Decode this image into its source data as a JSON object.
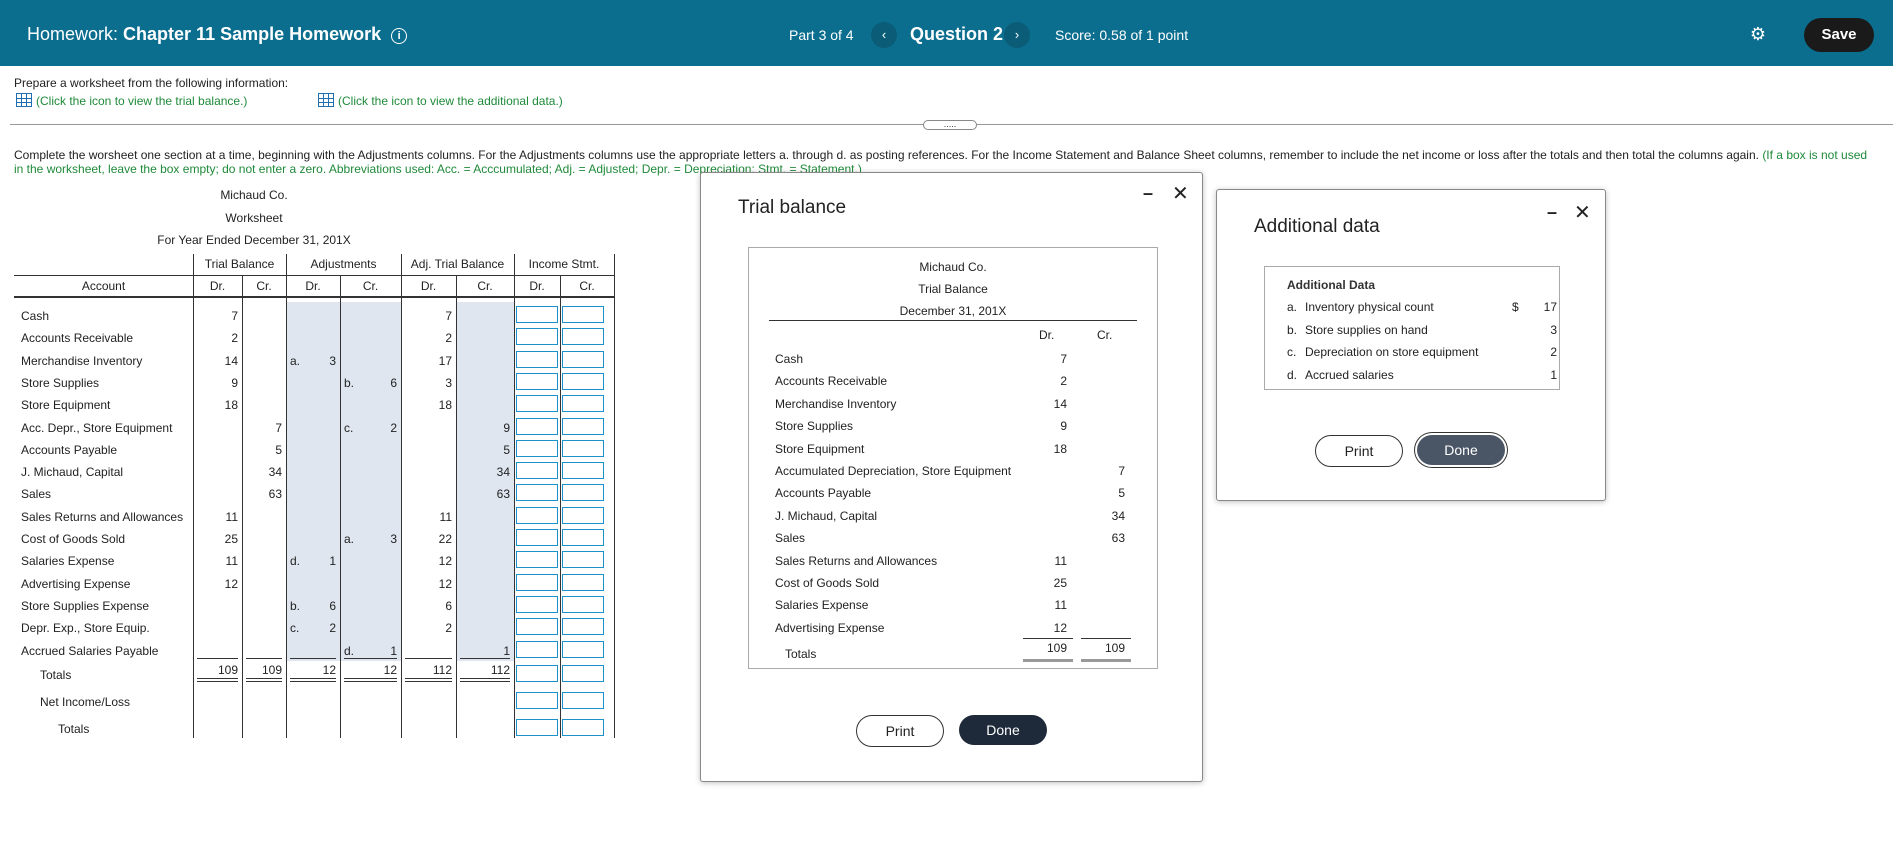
{
  "header": {
    "homework_prefix": "Homework:",
    "homework_title": "Chapter 11 Sample Homework",
    "part": "Part 3 of 4",
    "question": "Question 2",
    "score": "Score: 0.58 of 1 point",
    "save_label": "Save"
  },
  "prompt": {
    "prepare": "Prepare a worksheet from the following information:",
    "link_trial": "(Click the icon to view the trial balance.)",
    "link_additional": "(Click the icon to view the additional data.)",
    "instructions": "Complete the worsheet one section at a time, beginning with the Adjustments columns. For the Adjustments columns use the appropriate letters a. through d. as posting references. For the Income Statement and Balance Sheet columns, remember to include the net income or loss after the totals and then total the columns again.",
    "instructions_green": "(If a box is not used in the worksheet, leave the box empty; do not enter a zero. Abbreviations used: Acc. = Acccumulated; Adj. = Adjusted; Depr. = Depreciation; Stmt. = Statement.)"
  },
  "worksheet": {
    "company": "Michaud Co.",
    "title": "Worksheet",
    "period": "For Year Ended December 31, 201X",
    "groups": [
      "Trial Balance",
      "Adjustments",
      "Adj. Trial Balance",
      "Income Stmt."
    ],
    "account_header": "Account",
    "dr": "Dr.",
    "cr": "Cr.",
    "rows": [
      {
        "account": "Cash",
        "tb_dr": "7",
        "tb_cr": "",
        "adj_dr_ref": "",
        "adj_dr": "",
        "adj_cr_ref": "",
        "adj_cr": "",
        "atb_dr": "7",
        "atb_cr": ""
      },
      {
        "account": "Accounts Receivable",
        "tb_dr": "2",
        "tb_cr": "",
        "adj_dr_ref": "",
        "adj_dr": "",
        "adj_cr_ref": "",
        "adj_cr": "",
        "atb_dr": "2",
        "atb_cr": ""
      },
      {
        "account": "Merchandise Inventory",
        "tb_dr": "14",
        "tb_cr": "",
        "adj_dr_ref": "a.",
        "adj_dr": "3",
        "adj_cr_ref": "",
        "adj_cr": "",
        "atb_dr": "17",
        "atb_cr": ""
      },
      {
        "account": "Store Supplies",
        "tb_dr": "9",
        "tb_cr": "",
        "adj_dr_ref": "",
        "adj_dr": "",
        "adj_cr_ref": "b.",
        "adj_cr": "6",
        "atb_dr": "3",
        "atb_cr": ""
      },
      {
        "account": "Store Equipment",
        "tb_dr": "18",
        "tb_cr": "",
        "adj_dr_ref": "",
        "adj_dr": "",
        "adj_cr_ref": "",
        "adj_cr": "",
        "atb_dr": "18",
        "atb_cr": ""
      },
      {
        "account": "Acc. Depr., Store Equipment",
        "tb_dr": "",
        "tb_cr": "7",
        "adj_dr_ref": "",
        "adj_dr": "",
        "adj_cr_ref": "c.",
        "adj_cr": "2",
        "atb_dr": "",
        "atb_cr": "9"
      },
      {
        "account": "Accounts Payable",
        "tb_dr": "",
        "tb_cr": "5",
        "adj_dr_ref": "",
        "adj_dr": "",
        "adj_cr_ref": "",
        "adj_cr": "",
        "atb_dr": "",
        "atb_cr": "5"
      },
      {
        "account": "J. Michaud, Capital",
        "tb_dr": "",
        "tb_cr": "34",
        "adj_dr_ref": "",
        "adj_dr": "",
        "adj_cr_ref": "",
        "adj_cr": "",
        "atb_dr": "",
        "atb_cr": "34"
      },
      {
        "account": "Sales",
        "tb_dr": "",
        "tb_cr": "63",
        "adj_dr_ref": "",
        "adj_dr": "",
        "adj_cr_ref": "",
        "adj_cr": "",
        "atb_dr": "",
        "atb_cr": "63"
      },
      {
        "account": "Sales Returns and Allowances",
        "tb_dr": "11",
        "tb_cr": "",
        "adj_dr_ref": "",
        "adj_dr": "",
        "adj_cr_ref": "",
        "adj_cr": "",
        "atb_dr": "11",
        "atb_cr": ""
      },
      {
        "account": "Cost of Goods Sold",
        "tb_dr": "25",
        "tb_cr": "",
        "adj_dr_ref": "",
        "adj_dr": "",
        "adj_cr_ref": "a.",
        "adj_cr": "3",
        "atb_dr": "22",
        "atb_cr": ""
      },
      {
        "account": "Salaries Expense",
        "tb_dr": "11",
        "tb_cr": "",
        "adj_dr_ref": "d.",
        "adj_dr": "1",
        "adj_cr_ref": "",
        "adj_cr": "",
        "atb_dr": "12",
        "atb_cr": ""
      },
      {
        "account": "Advertising Expense",
        "tb_dr": "12",
        "tb_cr": "",
        "adj_dr_ref": "",
        "adj_dr": "",
        "adj_cr_ref": "",
        "adj_cr": "",
        "atb_dr": "12",
        "atb_cr": ""
      },
      {
        "account": "Store Supplies Expense",
        "tb_dr": "",
        "tb_cr": "",
        "adj_dr_ref": "b.",
        "adj_dr": "6",
        "adj_cr_ref": "",
        "adj_cr": "",
        "atb_dr": "6",
        "atb_cr": ""
      },
      {
        "account": "Depr. Exp., Store Equip.",
        "tb_dr": "",
        "tb_cr": "",
        "adj_dr_ref": "c.",
        "adj_dr": "2",
        "adj_cr_ref": "",
        "adj_cr": "",
        "atb_dr": "2",
        "atb_cr": ""
      },
      {
        "account": "Accrued Salaries Payable",
        "tb_dr": "",
        "tb_cr": "",
        "adj_dr_ref": "",
        "adj_dr": "",
        "adj_cr_ref": "d.",
        "adj_cr": "1",
        "atb_dr": "",
        "atb_cr": "1"
      }
    ],
    "totals_label": "Totals",
    "totals": {
      "tb_dr": "109",
      "tb_cr": "109",
      "adj_dr": "12",
      "adj_cr": "12",
      "atb_dr": "112",
      "atb_cr": "112"
    },
    "net_label": "Net Income/Loss",
    "final_totals_label": "Totals"
  },
  "trial_balance_modal": {
    "title": "Trial balance",
    "company": "Michaud Co.",
    "heading": "Trial Balance",
    "date": "December 31, 201X",
    "dr": "Dr.",
    "cr": "Cr.",
    "rows": [
      {
        "name": "Cash",
        "dr": "7",
        "cr": ""
      },
      {
        "name": "Accounts Receivable",
        "dr": "2",
        "cr": ""
      },
      {
        "name": "Merchandise Inventory",
        "dr": "14",
        "cr": ""
      },
      {
        "name": "Store Supplies",
        "dr": "9",
        "cr": ""
      },
      {
        "name": "Store Equipment",
        "dr": "18",
        "cr": ""
      },
      {
        "name": "Accumulated Depreciation, Store Equipment",
        "dr": "",
        "cr": "7"
      },
      {
        "name": "Accounts Payable",
        "dr": "",
        "cr": "5"
      },
      {
        "name": "J. Michaud, Capital",
        "dr": "",
        "cr": "34"
      },
      {
        "name": "Sales",
        "dr": "",
        "cr": "63"
      },
      {
        "name": "Sales Returns and Allowances",
        "dr": "11",
        "cr": ""
      },
      {
        "name": "Cost of Goods Sold",
        "dr": "25",
        "cr": ""
      },
      {
        "name": "Salaries Expense",
        "dr": "11",
        "cr": ""
      },
      {
        "name": "Advertising Expense",
        "dr": "12",
        "cr": ""
      }
    ],
    "totals_label": "Totals",
    "total_dr": "109",
    "total_cr": "109",
    "print_label": "Print",
    "done_label": "Done"
  },
  "additional_modal": {
    "title": "Additional data",
    "heading": "Additional Data",
    "items": [
      {
        "letter": "a.",
        "text": "Inventory physical count",
        "currency": "$",
        "value": "17"
      },
      {
        "letter": "b.",
        "text": "Store supplies on hand",
        "currency": "",
        "value": "3"
      },
      {
        "letter": "c.",
        "text": "Depreciation on store equipment",
        "currency": "",
        "value": "2"
      },
      {
        "letter": "d.",
        "text": "Accrued salaries",
        "currency": "",
        "value": "1"
      }
    ],
    "print_label": "Print",
    "done_label": "Done"
  }
}
